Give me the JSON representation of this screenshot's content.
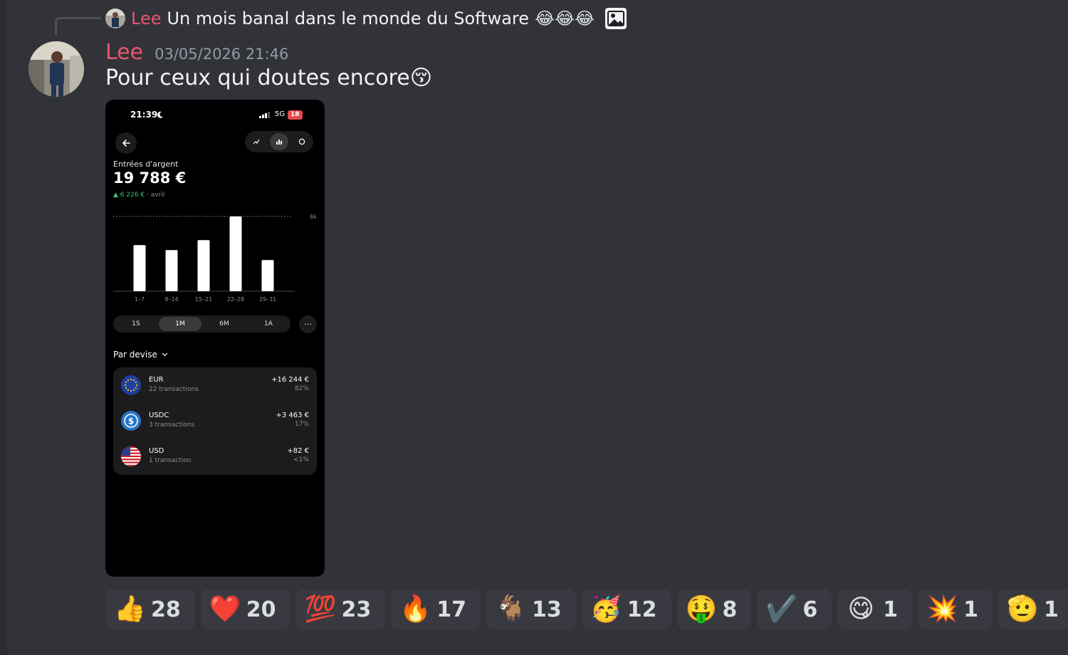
{
  "reply": {
    "author": "Lee",
    "text": "Un mois banal dans le monde du Software",
    "emojis": "😂😂😂",
    "attachment_icon": "image-icon"
  },
  "message": {
    "author": "Lee",
    "timestamp": "03/05/2026 21:46",
    "text": "Pour ceux qui doutes encore",
    "text_emoji": "😚"
  },
  "phone": {
    "status": {
      "time": "21:39",
      "network": "5G",
      "battery": "18"
    },
    "label": "Entrées d'argent",
    "amount": "19 788 €",
    "delta_value": "▲ 6 226 €",
    "delta_period": " · avril",
    "chart_data": {
      "type": "bar",
      "categories": [
        "1–7",
        "8–14",
        "15–21",
        "22–28",
        "29–31"
      ],
      "values": [
        3700,
        3300,
        4100,
        6000,
        2500
      ],
      "ylim": [
        0,
        6000
      ],
      "ytick_label": "6k",
      "bar_color": "#ffffff"
    },
    "periods": [
      "1S",
      "1M",
      "6M",
      "1A"
    ],
    "active_period": "1M",
    "more_label": "···",
    "group_label": "Par devise",
    "currencies": [
      {
        "code": "EUR",
        "transactions": "22 transactions",
        "amount": "+16 244 €",
        "percent": "82%"
      },
      {
        "code": "USDC",
        "transactions": "3 transactions",
        "amount": "+3 463 €",
        "percent": "17%"
      },
      {
        "code": "USD",
        "transactions": "1 transaction",
        "amount": "+82 €",
        "percent": "<1%"
      }
    ]
  },
  "reactions": [
    {
      "emoji": "👍",
      "count": "28"
    },
    {
      "emoji": "❤️",
      "count": "20"
    },
    {
      "emoji": "💯",
      "count": "23"
    },
    {
      "emoji": "🔥",
      "count": "17"
    },
    {
      "emoji": "🐐",
      "count": "13"
    },
    {
      "emoji": "🥳",
      "count": "12"
    },
    {
      "emoji": "🤑",
      "count": "8"
    },
    {
      "emoji": "✔️",
      "count": "6"
    },
    {
      "emoji": "😋",
      "count": "1"
    },
    {
      "emoji": "💥",
      "count": "1"
    },
    {
      "emoji": "🫡",
      "count": "1"
    }
  ],
  "colors": {
    "background": "#313338",
    "author": "#e8566f",
    "timestamp": "#949ba4",
    "reaction_bg": "#393a41",
    "positive": "#30c77b"
  }
}
